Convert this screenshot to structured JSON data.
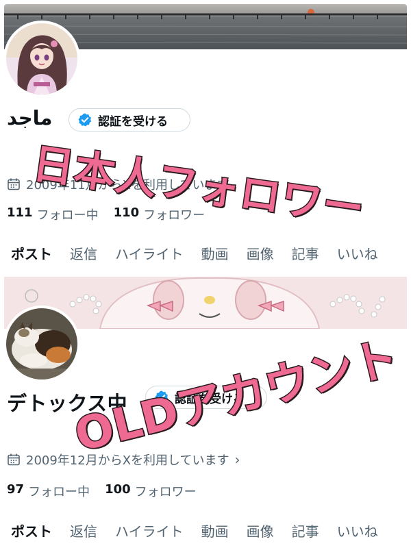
{
  "profiles": [
    {
      "display_name": "ماجد",
      "verify_button_label": "認証を受ける",
      "joined_text": "2009年11月からXを利用しています",
      "following_count": "111",
      "following_label": "フォロー中",
      "followers_count": "110",
      "followers_label": "フォロワー",
      "tabs": [
        "ポスト",
        "返信",
        "ハイライト",
        "動画",
        "画像",
        "記事",
        "いいね"
      ],
      "overlay_text": "日本人フォロワー",
      "banner": "sea-bridge-sunset",
      "avatar": "anime-girl-kimono"
    },
    {
      "display_name": "デトックス中",
      "verify_button_label": "認証を受ける",
      "joined_text": "2009年12月からXを利用しています",
      "following_count": "97",
      "following_label": "フォロー中",
      "followers_count": "100",
      "followers_label": "フォロワー",
      "tabs": [
        "ポスト",
        "返信",
        "ハイライト",
        "動画",
        "画像",
        "記事",
        "いいね"
      ],
      "overlay_text": "OLDアカウント",
      "banner": "pink-character-pearls",
      "avatar": "calico-cat"
    }
  ],
  "colors": {
    "overlay_fill": "#ef6a93",
    "overlay_stroke": "#2a1a1e",
    "verified_blue": "#1d9bf0",
    "secondary_text": "#536471"
  },
  "icons": [
    "verified-badge-icon",
    "calendar-icon",
    "chevron-right-icon"
  ]
}
